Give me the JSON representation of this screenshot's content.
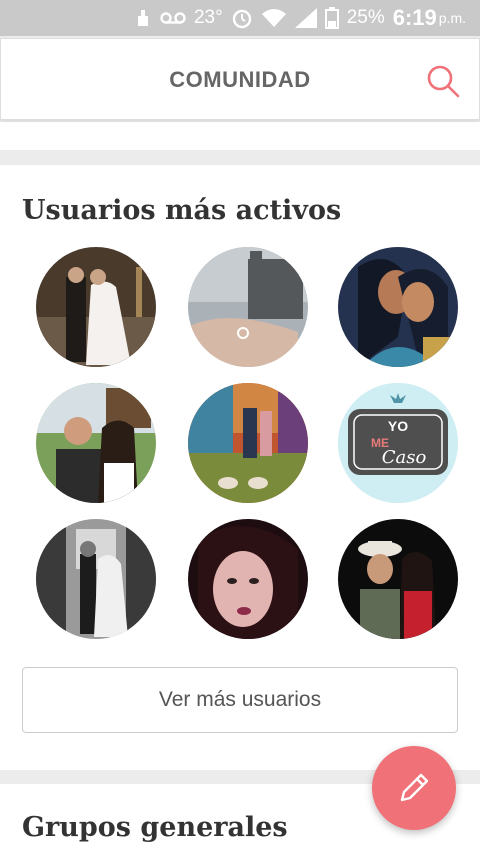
{
  "status_bar": {
    "temperature": "23°",
    "battery": "25%",
    "time": "6:19",
    "ampm": "p.m."
  },
  "header": {
    "title": "COMUNIDAD"
  },
  "active_users": {
    "heading": "Usuarios más activos",
    "avatars": [
      {
        "name": "wedding-couple-church"
      },
      {
        "name": "ring-hand-sunset"
      },
      {
        "name": "cartoon-couple-kiss"
      },
      {
        "name": "couple-selfie-outdoors"
      },
      {
        "name": "couple-mosaic-wall"
      },
      {
        "name": "yo-me-caso-sign"
      },
      {
        "name": "bw-couple-photo"
      },
      {
        "name": "woman-closeup"
      },
      {
        "name": "couple-cowboy-hat"
      }
    ],
    "avatar_badge_text": {
      "line1": "YO",
      "line2": "ME",
      "line3": "Caso"
    },
    "more_button": "Ver más usuarios"
  },
  "groups": {
    "heading": "Grupos generales"
  },
  "colors": {
    "accent": "#f07178",
    "statusbar": "#c9c9c9"
  }
}
